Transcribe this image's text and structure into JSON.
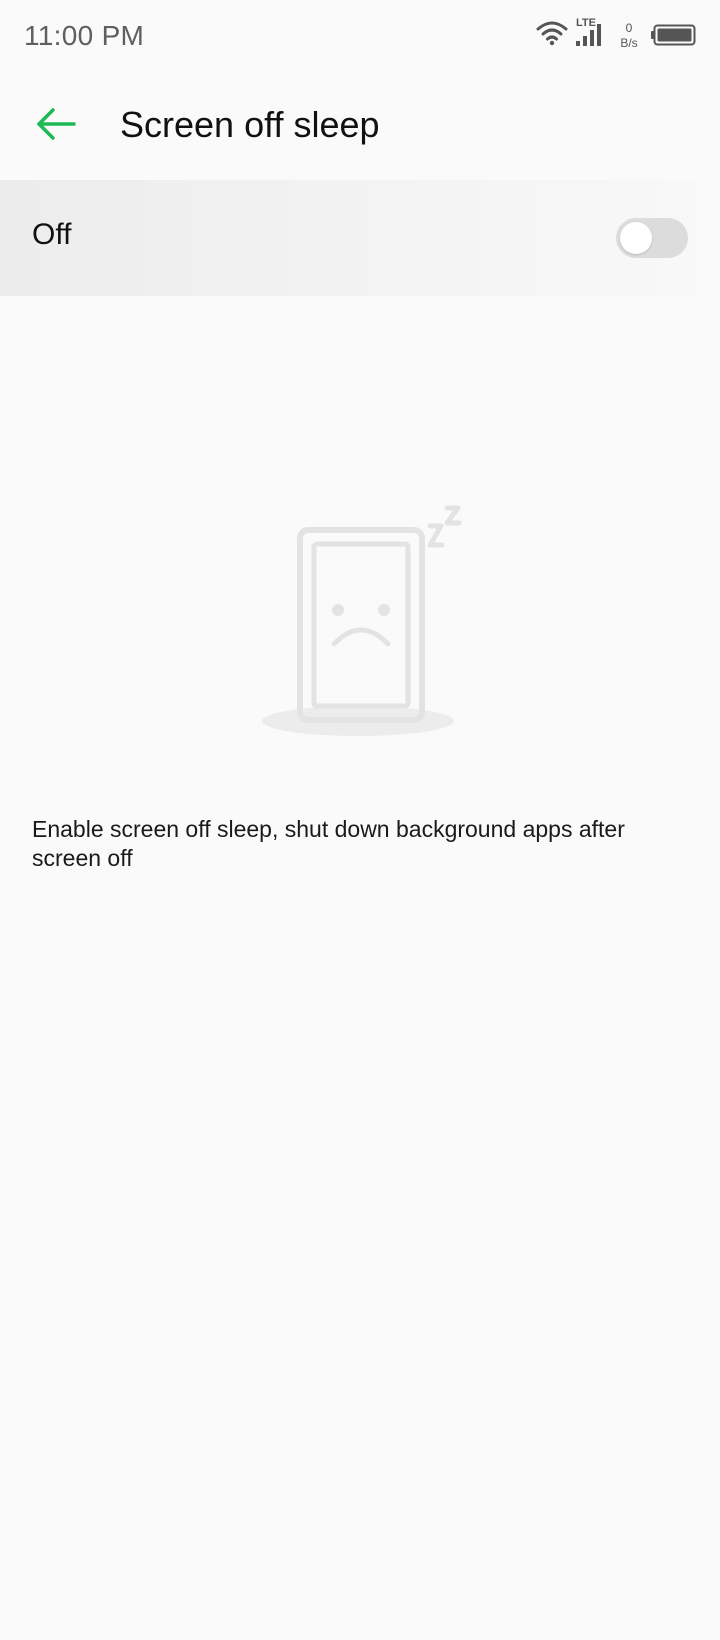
{
  "status_bar": {
    "time": "11:00 PM",
    "network_type": "LTE",
    "net_speed_value": "0",
    "net_speed_unit": "B/s",
    "icons": [
      "wifi-icon",
      "signal-icon",
      "battery-icon"
    ]
  },
  "header": {
    "back_icon": "arrow-left-icon",
    "title": "Screen off sleep"
  },
  "toggle": {
    "label": "Off",
    "state": "off"
  },
  "illustration": {
    "icon": "sleeping-phone-icon"
  },
  "description": "Enable screen off sleep, shut down background apps after screen off",
  "colors": {
    "accent": "#1db954",
    "background": "#fafafa",
    "switch_track_off": "#dcdcdc"
  }
}
